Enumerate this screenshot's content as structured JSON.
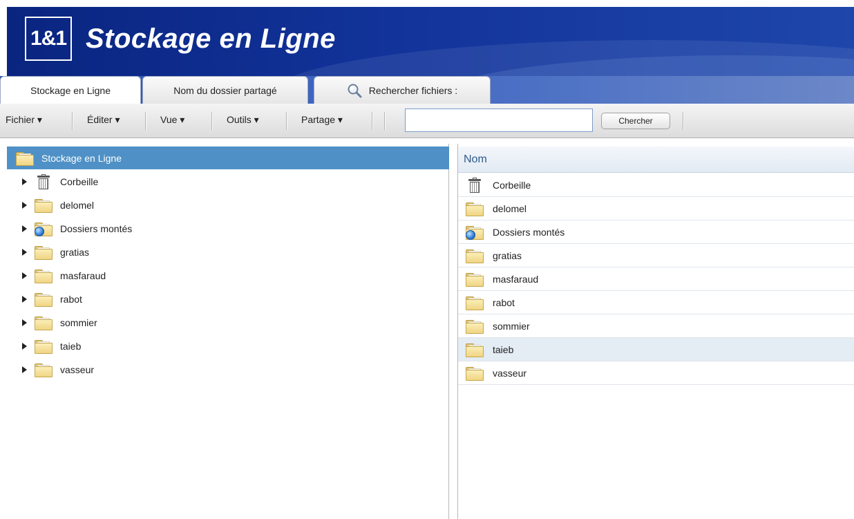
{
  "app": {
    "logo_text": "1&1",
    "title": "Stockage en Ligne"
  },
  "tabs": [
    {
      "label": "Stockage en Ligne",
      "active": true
    },
    {
      "label": "Nom du dossier partagé",
      "active": false
    },
    {
      "label": "Rechercher fichiers :",
      "active": false,
      "icon": "magnifier-icon"
    }
  ],
  "toolbar": {
    "menus": [
      "Fichier ▾",
      "Éditer ▾",
      "Vue ▾",
      "Outils ▾",
      "Partage ▾"
    ],
    "search_value": "",
    "search_button": "Chercher"
  },
  "tree": {
    "root": {
      "label": "Stockage en Ligne",
      "icon": "folder-open-icon",
      "selected": true
    },
    "items": [
      {
        "label": "Corbeille",
        "icon": "trash-icon"
      },
      {
        "label": "delomel",
        "icon": "folder-icon"
      },
      {
        "label": "Dossiers montés",
        "icon": "mounted-folder-icon"
      },
      {
        "label": "gratias",
        "icon": "folder-icon"
      },
      {
        "label": "masfaraud",
        "icon": "folder-icon"
      },
      {
        "label": "rabot",
        "icon": "folder-icon"
      },
      {
        "label": "sommier",
        "icon": "folder-icon"
      },
      {
        "label": "taieb",
        "icon": "folder-icon"
      },
      {
        "label": "vasseur",
        "icon": "folder-icon"
      }
    ]
  },
  "list": {
    "column_header": "Nom",
    "rows": [
      {
        "label": "Corbeille",
        "icon": "trash-icon",
        "selected": false
      },
      {
        "label": "delomel",
        "icon": "folder-icon",
        "selected": false
      },
      {
        "label": "Dossiers montés",
        "icon": "mounted-folder-icon",
        "selected": false
      },
      {
        "label": "gratias",
        "icon": "folder-icon",
        "selected": false
      },
      {
        "label": "masfaraud",
        "icon": "folder-icon",
        "selected": false
      },
      {
        "label": "rabot",
        "icon": "folder-icon",
        "selected": false
      },
      {
        "label": "sommier",
        "icon": "folder-icon",
        "selected": false
      },
      {
        "label": "taieb",
        "icon": "folder-icon",
        "selected": true
      },
      {
        "label": "vasseur",
        "icon": "folder-icon",
        "selected": false
      }
    ]
  },
  "colors": {
    "banner_dark": "#0a2580",
    "banner_light": "#1e46ab",
    "tree_selected": "#4f91c6",
    "list_selected": "#e4ecf4",
    "header_text": "#2f5a8a"
  }
}
